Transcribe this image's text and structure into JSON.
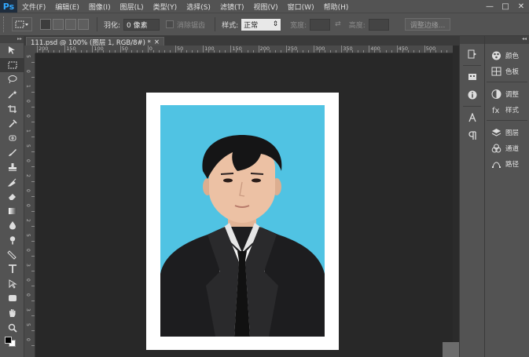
{
  "app": {
    "logo": "Ps"
  },
  "menu": [
    "文件(F)",
    "编辑(E)",
    "图像(I)",
    "图层(L)",
    "类型(Y)",
    "选择(S)",
    "滤镜(T)",
    "视图(V)",
    "窗口(W)",
    "帮助(H)"
  ],
  "window_controls": {
    "minimize": "—",
    "restore": "□",
    "close": "✕"
  },
  "options": {
    "feather_label": "羽化:",
    "feather_value": "0 像素",
    "antialias_label": "消除锯齿",
    "style_label": "样式:",
    "style_value": "正常",
    "width_label": "宽度:",
    "height_label": "高度:",
    "refine_edge": "调整边缘..."
  },
  "document": {
    "tab_title": "111.psd @ 100% (图层 1, RGB/8#) *",
    "tab_close": "×"
  },
  "ruler_h_labels": [
    "200",
    "150",
    "100",
    "50",
    "0",
    "50",
    "100",
    "150",
    "200",
    "250",
    "300",
    "350",
    "400",
    "450",
    "500"
  ],
  "ruler_v_labels": [
    "5",
    "0",
    "1",
    "0",
    "0",
    "1",
    "5",
    "0",
    "2",
    "0",
    "0",
    "2",
    "5",
    "0",
    "3",
    "0",
    "0",
    "3",
    "5",
    "0"
  ],
  "panels_narrow": [
    "history-icon",
    "properties-icon",
    "info-icon",
    "character-icon",
    "paragraph-icon"
  ],
  "panels_wide": {
    "group1": [
      {
        "icon": "color-icon",
        "label": "颜色"
      },
      {
        "icon": "swatches-icon",
        "label": "色板"
      }
    ],
    "group2": [
      {
        "icon": "adjustments-icon",
        "label": "调整"
      },
      {
        "icon": "styles-icon",
        "label": "样式"
      }
    ],
    "group3": [
      {
        "icon": "layers-icon",
        "label": "图层"
      },
      {
        "icon": "channels-icon",
        "label": "通道"
      },
      {
        "icon": "paths-icon",
        "label": "路径"
      }
    ]
  },
  "colors": {
    "photo_background": "#50c3e3",
    "canvas": "#282828",
    "chrome": "#535353",
    "ps_blue": "#31a8ff"
  }
}
